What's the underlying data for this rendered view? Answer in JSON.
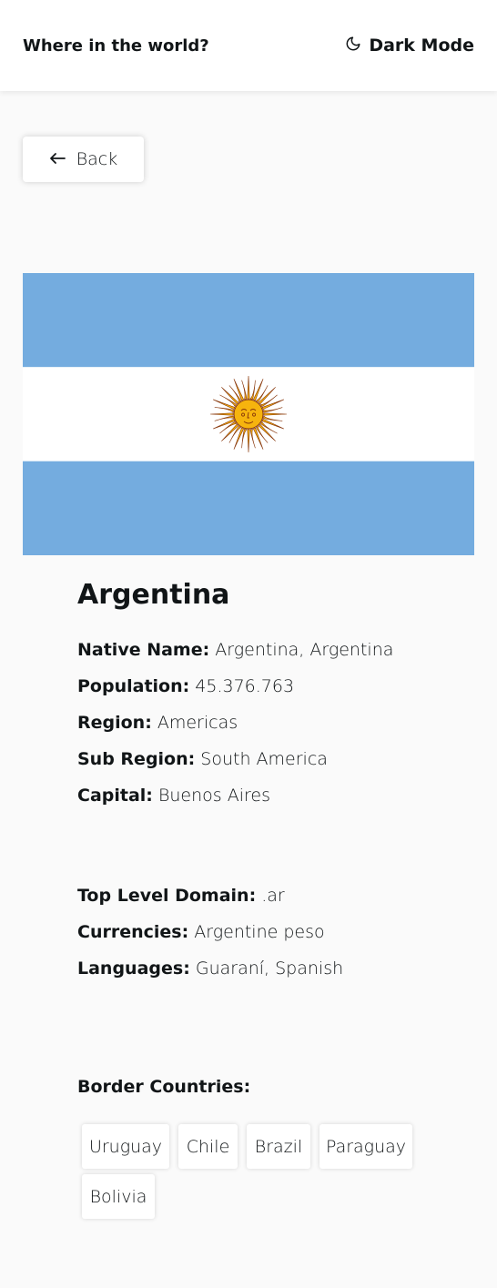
{
  "header": {
    "title": "Where in the world?",
    "dark_mode_label": "Dark Mode",
    "icon": "moon-icon"
  },
  "back_button": {
    "label": "Back",
    "icon": "arrow-left-icon"
  },
  "flag": {
    "country": "Argentina",
    "colors": {
      "stripe_blue": "#74ACDF",
      "stripe_white": "#FFFFFF",
      "sun": "#F6B40E",
      "sun_outline": "#85340A"
    }
  },
  "country": {
    "name": "Argentina",
    "native_name_label": "Native Name:",
    "native_name": "Argentina, Argentina",
    "population_label": "Population:",
    "population": "45.376.763",
    "region_label": "Region:",
    "region": "Americas",
    "sub_region_label": "Sub Region:",
    "sub_region": "South America",
    "capital_label": "Capital:",
    "capital": "Buenos Aires",
    "tld_label": "Top Level Domain:",
    "tld": ".ar",
    "currencies_label": "Currencies:",
    "currencies": "Argentine peso",
    "languages_label": "Languages:",
    "languages": "Guaraní, Spanish"
  },
  "borders": {
    "title": "Border Countries:",
    "countries": [
      "Uruguay",
      "Chile",
      "Brazil",
      "Paraguay",
      "Bolivia"
    ]
  },
  "colors": {
    "background": "#FAFAFA",
    "surface": "#FFFFFF",
    "text": "#111517"
  }
}
